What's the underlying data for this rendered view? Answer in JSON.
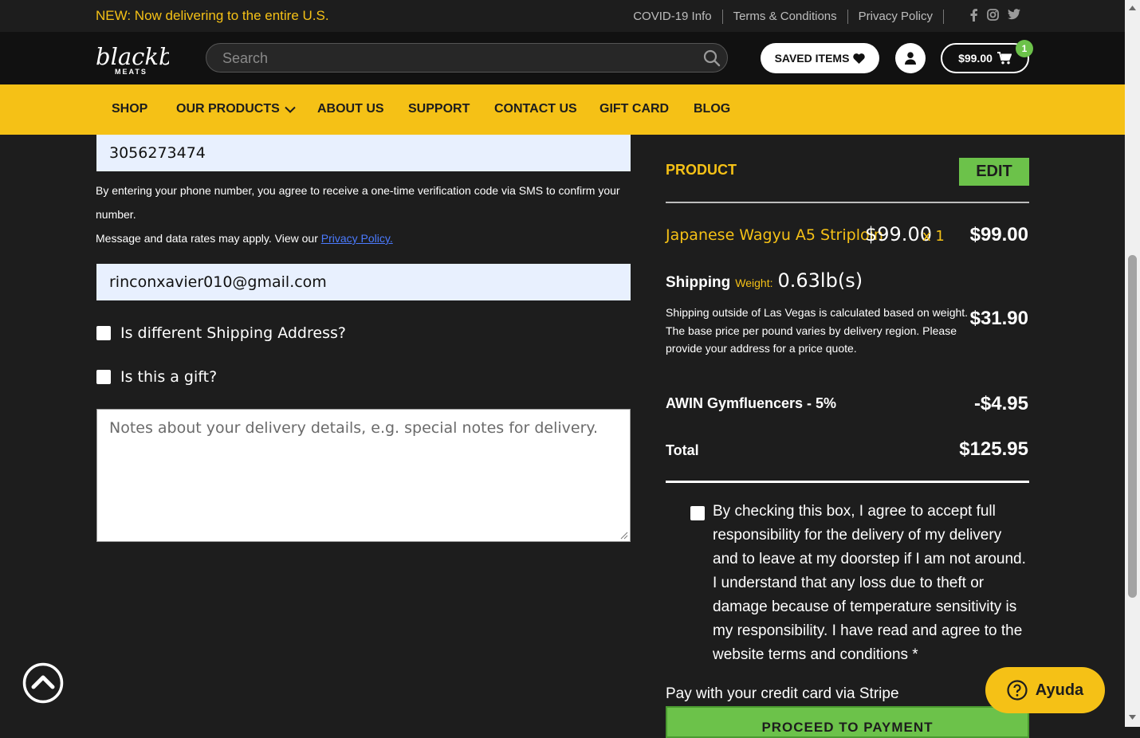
{
  "topbar": {
    "announcement": "NEW: Now delivering to the entire U.S.",
    "links": [
      "COVID-19 Info",
      "Terms & Conditions",
      "Privacy Policy"
    ],
    "social": [
      "facebook-icon",
      "instagram-icon",
      "twitter-icon"
    ]
  },
  "header": {
    "logo_text": "blackbox",
    "logo_sub": "MEATS",
    "search_placeholder": "Search",
    "saved_label": "SAVED ITEMS",
    "cart_total": "$99.00",
    "cart_count": "1"
  },
  "nav": {
    "items": [
      "SHOP",
      "OUR PRODUCTS",
      "ABOUT US",
      "SUPPORT",
      "CONTACT US",
      "GIFT CARD",
      "BLOG"
    ]
  },
  "form": {
    "phone_value": "3056273474",
    "phone_consent": "By entering your phone number, you agree to receive a one-time verification code via SMS to confirm your number.",
    "rates_text": "Message and data rates may apply. View our ",
    "privacy_link": "Privacy Policy.",
    "email_value": "rinconxavier010@gmail.com",
    "diff_shipping_label": "Is different Shipping Address?",
    "gift_label": "Is this a gift?",
    "notes_placeholder": "Notes about your delivery details, e.g. special notes for delivery."
  },
  "summary": {
    "product_header": "PRODUCT",
    "edit_label": "EDIT",
    "item_name": "Japanese Wagyu A5 Striploin",
    "item_price": "$99.00",
    "item_qty": "x 1",
    "item_total": "$99.00",
    "shipping_label": "Shipping",
    "weight_label": "Weight:",
    "weight_value": "0.63lb(s)",
    "shipping_note": "Shipping outside of Las Vegas is calculated based on weight. The base price per pound varies by delivery region. Please provide your address for a price quote.",
    "shipping_price": "$31.90",
    "discount_label": "AWIN Gymfluencers - 5%",
    "discount_value": "-$4.95",
    "total_label": "Total",
    "total_value": "$125.95",
    "agree_text": "By checking this box, I agree to accept full responsibility for the delivery of my delivery and to leave at my doorstep if I am not around. I understand that any loss due to theft or damage because of temperature sensitivity is my responsibility. I have read and agree to the website terms and conditions *",
    "stripe_label": "Pay with your credit card via Stripe",
    "proceed_label": "PROCEED TO PAYMENT"
  },
  "help": {
    "label": "Ayuda"
  },
  "colors": {
    "brand_yellow": "#f5c116",
    "accent_green": "#6cc24a",
    "background": "#1d1d1d"
  }
}
